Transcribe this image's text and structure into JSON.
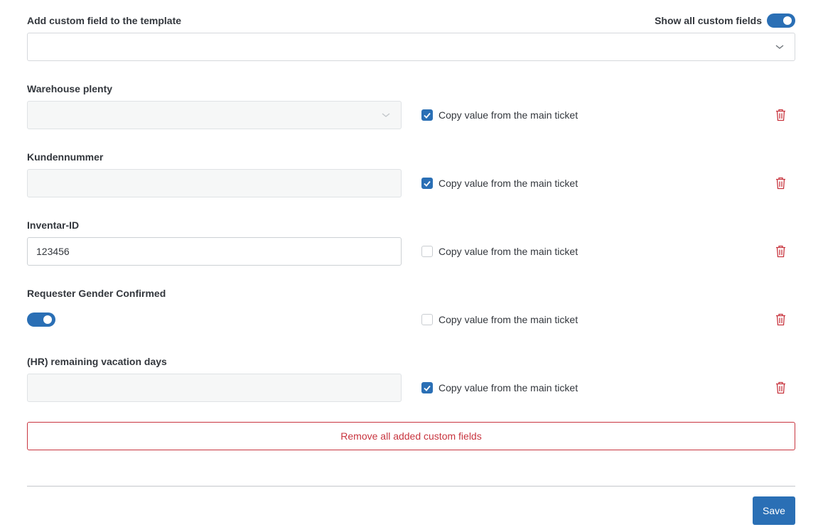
{
  "header": {
    "add_field_label": "Add custom field to the template",
    "show_all_label": "Show all custom fields",
    "show_all_enabled": true,
    "select_value": ""
  },
  "fields": [
    {
      "label": "Warehouse plenty",
      "type": "select",
      "value": "",
      "copy_label": "Copy value from the main ticket",
      "copy_checked": true
    },
    {
      "label": "Kundennummer",
      "type": "text",
      "value": "",
      "copy_label": "Copy value from the main ticket",
      "copy_checked": true
    },
    {
      "label": "Inventar-ID",
      "type": "text",
      "value": "123456",
      "copy_label": "Copy value from the main ticket",
      "copy_checked": false
    },
    {
      "label": "Requester Gender Confirmed",
      "type": "toggle",
      "value": true,
      "copy_label": "Copy value from the main ticket",
      "copy_checked": false
    },
    {
      "label": "(HR) remaining vacation days",
      "type": "text",
      "value": "",
      "copy_label": "Copy value from the main ticket",
      "copy_checked": true
    }
  ],
  "actions": {
    "remove_all_label": "Remove all added custom fields",
    "save_label": "Save"
  },
  "colors": {
    "primary": "#2a6fb5",
    "danger": "#c8353f",
    "disabled_bg": "#f6f7f7"
  },
  "icons": {
    "dropdown": "chevron-down-icon",
    "delete": "trash-icon",
    "check": "checkmark-icon"
  }
}
